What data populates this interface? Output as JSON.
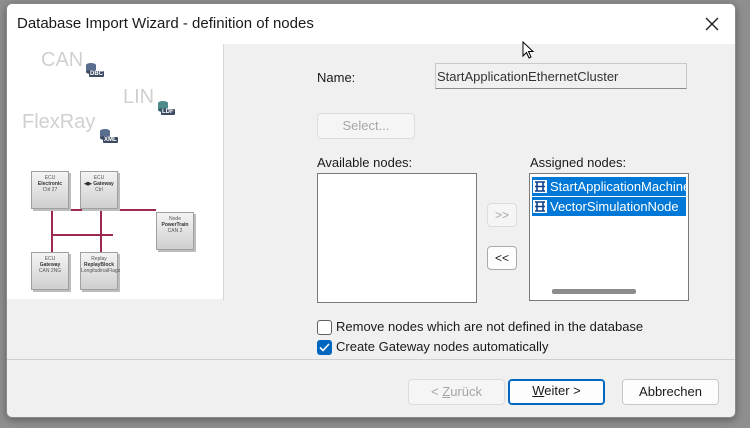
{
  "window": {
    "title": "Database Import Wizard - definition of nodes"
  },
  "illustration": {
    "protocols": [
      "CAN",
      "LIN",
      "FlexRay"
    ],
    "db_extensions": [
      "DBC",
      "LDF",
      "XML"
    ],
    "nodes": [
      {
        "top": "ECU",
        "main": "Electronic",
        "sub": "Ctrl 27"
      },
      {
        "top": "ECU",
        "main": "◀▶ Gateway",
        "sub": "Ctrl"
      },
      {
        "top": "Node",
        "main": "PowerTrain",
        "sub": "CAN 2"
      },
      {
        "top": "ECU",
        "main": "Gateway",
        "sub": "CAN 2NG"
      },
      {
        "top": "Replay",
        "main": "ReplayBlock",
        "sub": "LongitudinalFlags"
      }
    ],
    "bus_color": "#9c2a4e"
  },
  "form": {
    "name_label": "Name:",
    "name_value": "StartApplicationEthernetCluster",
    "select_button": "Select...",
    "available_label": "Available nodes:",
    "assigned_label": "Assigned nodes:",
    "available_nodes": [],
    "assigned_nodes": [
      "StartApplicationMachine",
      "VectorSimulationNode"
    ],
    "move_right": ">>",
    "move_left": "<<",
    "remove_nodes_label": "Remove nodes which are not defined in the database",
    "remove_nodes_checked": false,
    "create_gateway_label": "Create Gateway nodes automatically",
    "create_gateway_checked": true
  },
  "footer": {
    "back_underline": "Z",
    "back_rest": "urück",
    "back_prefix": "< ",
    "next_underline": "W",
    "next_rest": "eiter >",
    "cancel_label": "Abbrechen"
  },
  "colors": {
    "selection": "#0078d7",
    "checkbox_accent": "#0067c0"
  }
}
